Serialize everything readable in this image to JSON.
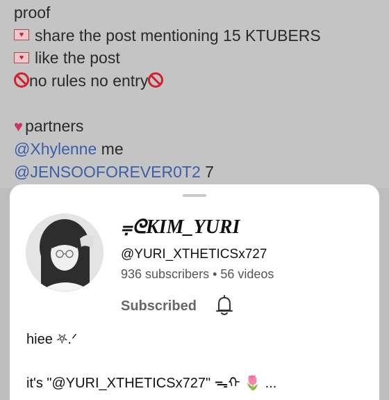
{
  "post": {
    "line_proof": "proof",
    "line_share": "share the post mentioning 15 KTUBERS",
    "line_like": "like the post",
    "line_rules": "no rules no entry",
    "line_partners": "partners",
    "partner1_handle": "@Xhylenne",
    "partner1_suffix": " me",
    "partner2_handle": "@JENSOOFOREVER0T2",
    "partner2_suffix": " 7"
  },
  "channel_sheet": {
    "name": "⩦ᘓKIM_YURI",
    "handle": "@YURI_XTHETICSx727",
    "stats": "936 subscribers • 56 videos",
    "subscribe_label": "Subscribed",
    "description_line1": "hiee ⛧.ᐟ",
    "description_line2_text": "it's \"@YURI_XTHETICSx727\" ᯓᡣ",
    "description_line2_tulip": "🌷",
    "description_line2_more": " ..."
  },
  "colors": {
    "link": "#3b5fa8",
    "no_entry_red": "#d4202c",
    "heart": "#c8375f",
    "sheet_bg": "#ffffff",
    "dimmed_bg": "#c4c4c4"
  },
  "icons": {
    "envelope": "love-letter-icon",
    "no_entry": "no-entry-icon",
    "heart": "heart-icon",
    "bell": "bell-icon"
  }
}
